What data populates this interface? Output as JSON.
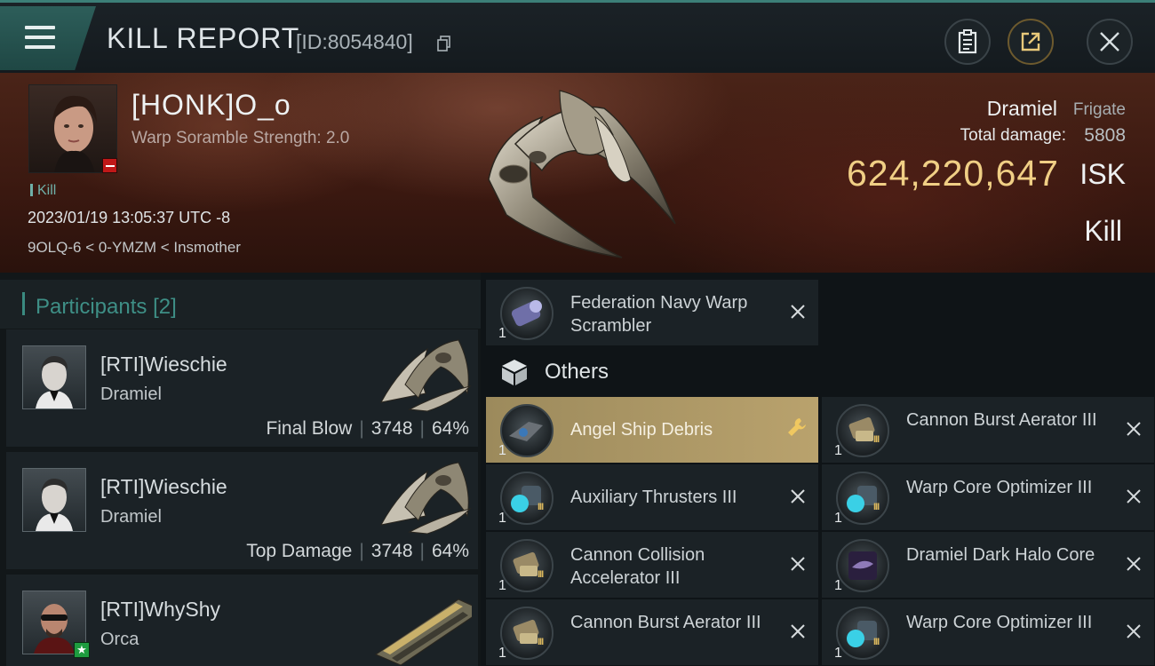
{
  "header": {
    "title": "KILL REPORT",
    "report_id": "[ID:8054840]"
  },
  "victim": {
    "name": "[HONK]O_o",
    "scramble_strength": "Warp Soramble Strength: 2.0",
    "tag": "Kill",
    "datetime": "2023/01/19 13:05:37 UTC -8",
    "location": "9OLQ-6 < 0-YMZM < Insmother",
    "ship_name": "Dramiel",
    "ship_class": "Frigate",
    "total_damage_label": "Total damage:",
    "total_damage": "5808",
    "isk_value": "624,220,647",
    "isk_unit": "ISK",
    "result": "Kill"
  },
  "participants": {
    "title": "Participants",
    "count": "[2]",
    "rows": [
      {
        "name": "[RTI]Wieschie",
        "ship": "Dramiel",
        "role": "Final Blow",
        "damage": "3748",
        "percent": "64%"
      },
      {
        "name": "[RTI]Wieschie",
        "ship": "Dramiel",
        "role": "Top Damage",
        "damage": "3748",
        "percent": "64%"
      },
      {
        "name": "[RTI]WhyShy",
        "ship": "Orca"
      }
    ]
  },
  "items": {
    "top_item": {
      "name": "Federation Navy Warp Scrambler",
      "qty": "1"
    },
    "others_label": "Others",
    "list": [
      {
        "name": "Angel Ship Debris",
        "qty": "1"
      },
      {
        "name": "Cannon Burst Aerator III",
        "qty": "1",
        "tier": "III"
      },
      {
        "name": "Auxiliary Thrusters III",
        "qty": "1",
        "tier": "III"
      },
      {
        "name": "Warp Core Optimizer III",
        "qty": "1",
        "tier": "III"
      },
      {
        "name": "Cannon Collision Accelerator III",
        "qty": "1",
        "tier": "III"
      },
      {
        "name": "Dramiel Dark Halo Core",
        "qty": "1"
      },
      {
        "name": "Cannon Burst Aerator III",
        "qty": "1",
        "tier": "III"
      },
      {
        "name": "Warp Core Optimizer III",
        "qty": "1",
        "tier": "III"
      }
    ]
  },
  "colors": {
    "accent_teal": "#3e8f86",
    "isk_gold": "#f0cf85",
    "highlight_gold": "#b9a26d"
  },
  "icons": [
    "menu-icon",
    "copy-icon",
    "clipboard-icon",
    "share-icon",
    "close-icon",
    "cube-icon",
    "wrench-icon"
  ]
}
